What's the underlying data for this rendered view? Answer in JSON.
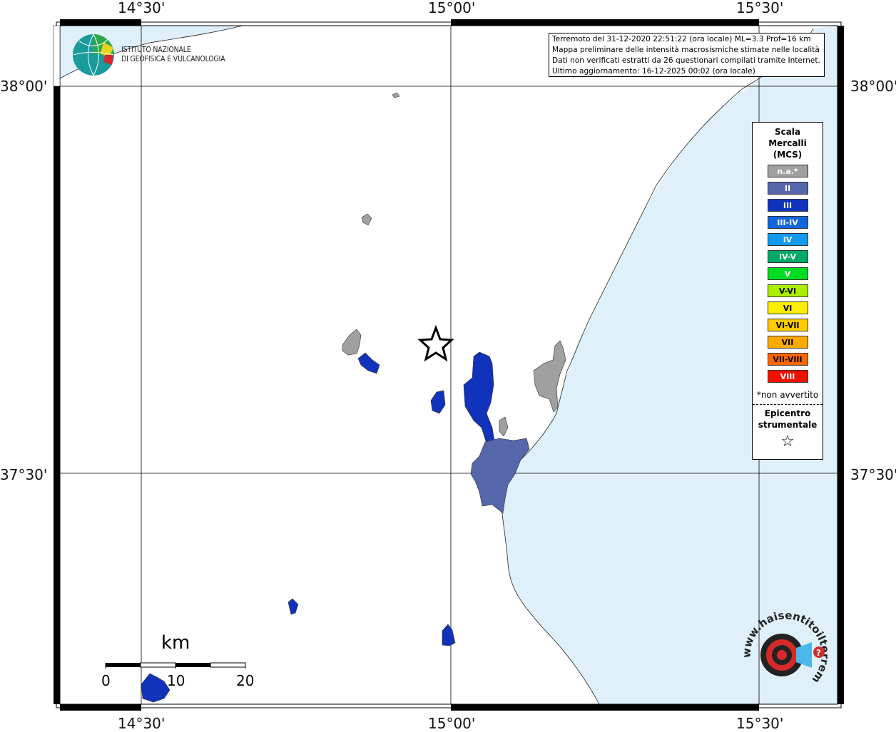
{
  "title_box": {
    "line1": "Terremoto del 31-12-2020 22:51:22 (ora locale) ML=3.3 Prof=16 km",
    "line2": "Mappa preliminare delle intensità macrosismiche stimate nelle località",
    "line3": "Dati non verificati estratti da 26 questionari compilati tramite Internet.",
    "line4": "Ultimo aggiornamento: 16-12-2025 00:02 (ora locale)"
  },
  "institute": {
    "line1": "ISTITUTO NAZIONALE",
    "line2": "DI GEOFISICA E VULCANOLOGIA"
  },
  "coords": {
    "top": [
      "14°30'",
      "15°00'",
      "15°30'"
    ],
    "bottom": [
      "14°30'",
      "15°00'",
      "15°30'"
    ],
    "left": [
      "38°00'",
      "37°30'"
    ],
    "right": [
      "38°00'",
      "37°30'"
    ]
  },
  "legend": {
    "title": [
      "Scala",
      "Mercalli",
      "(MCS)"
    ],
    "items": [
      {
        "label": "n.a.*",
        "color": "#a0a0a0"
      },
      {
        "label": "II",
        "color": "#5566aa"
      },
      {
        "label": "III",
        "color": "#1133bb"
      },
      {
        "label": "III-IV",
        "color": "#1166dd"
      },
      {
        "label": "IV",
        "color": "#1199ee"
      },
      {
        "label": "IV-V",
        "color": "#00aa66"
      },
      {
        "label": "V",
        "color": "#00dd22"
      },
      {
        "label": "V-VI",
        "color": "#aaee00"
      },
      {
        "label": "VI",
        "color": "#ffee00"
      },
      {
        "label": "VI-VII",
        "color": "#ffcc00"
      },
      {
        "label": "VII",
        "color": "#ffaa00"
      },
      {
        "label": "VII-VIII",
        "color": "#ff6600"
      },
      {
        "label": "VIII",
        "color": "#ee1100"
      }
    ],
    "note": "*non avvertito",
    "epicentre": [
      "Epicentro",
      "strumentale"
    ]
  },
  "scale": {
    "unit": "km",
    "labels": [
      "0",
      "10",
      "20"
    ]
  },
  "watermark": {
    "text": "www.haisentitoilterremoto.it"
  },
  "colors": {
    "sea": "#dff0fb",
    "intensity_na": "#a0a0a0",
    "intensity_II": "#5566aa",
    "intensity_III": "#1133bb"
  }
}
